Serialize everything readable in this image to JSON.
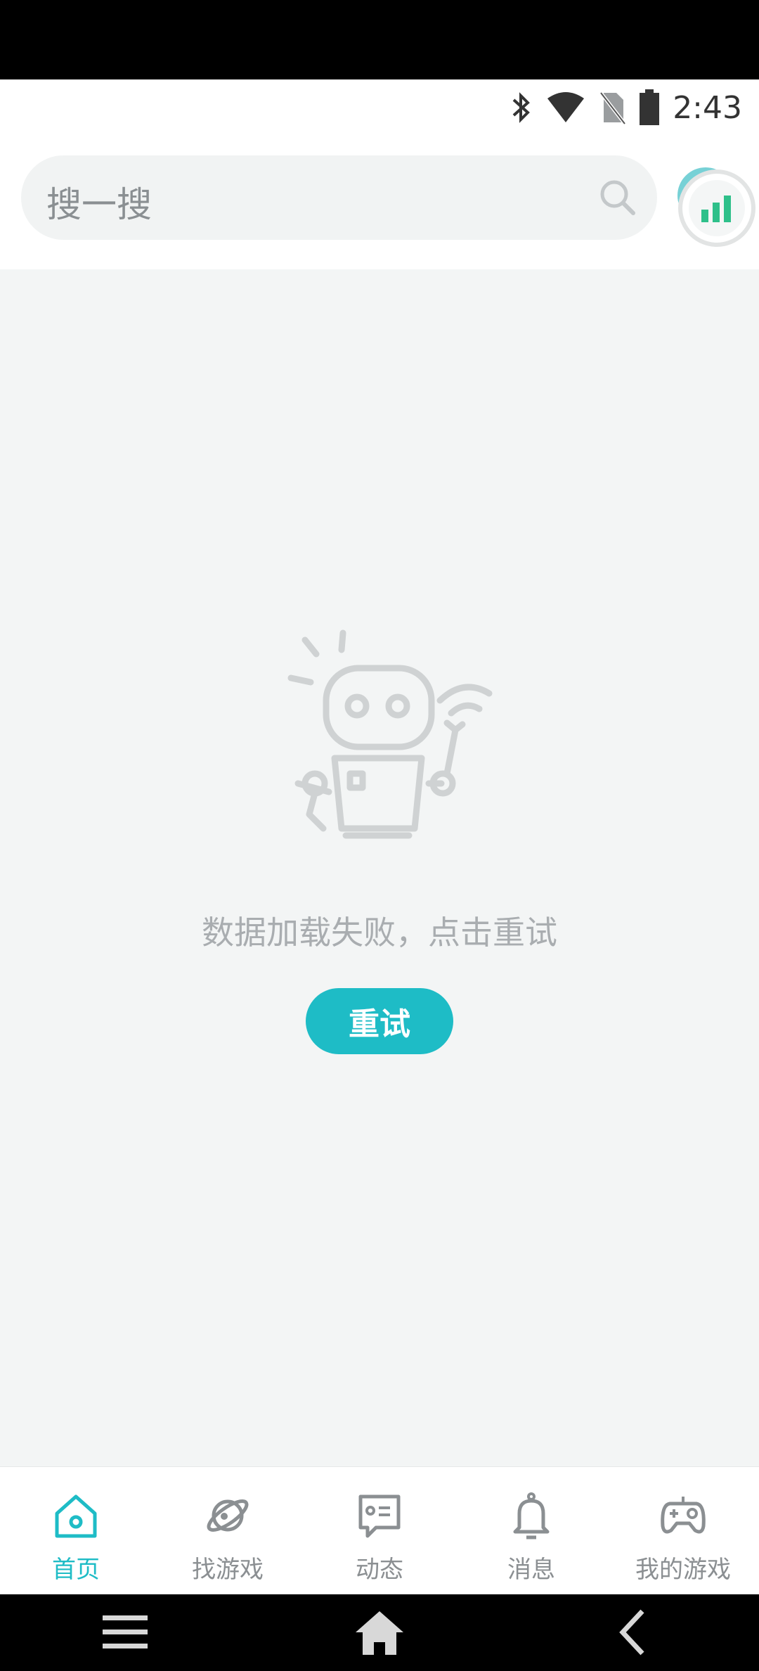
{
  "status_bar": {
    "time": "2:43",
    "icons": [
      "bluetooth-icon",
      "wifi-icon",
      "no-sim-icon",
      "battery-icon"
    ]
  },
  "search": {
    "placeholder": "搜一搜",
    "icon": "search-icon"
  },
  "avatar": {
    "icon": "signal-bars-icon"
  },
  "error": {
    "message": "数据加载失败，点击重试",
    "retry_label": "重试",
    "illustration": "robot-icon"
  },
  "tabs": [
    {
      "label": "首页",
      "icon": "home-icon",
      "active": true
    },
    {
      "label": "找游戏",
      "icon": "planet-icon",
      "active": false
    },
    {
      "label": "动态",
      "icon": "message-card-icon",
      "active": false
    },
    {
      "label": "消息",
      "icon": "bell-icon",
      "active": false
    },
    {
      "label": "我的游戏",
      "icon": "gamepad-icon",
      "active": false
    }
  ],
  "nav_bar": {
    "buttons": [
      "menu-icon",
      "home-nav-icon",
      "back-icon"
    ]
  },
  "colors": {
    "accent": "#1ebcc6",
    "muted_text": "#8b8f92",
    "background": "#f3f5f5"
  }
}
